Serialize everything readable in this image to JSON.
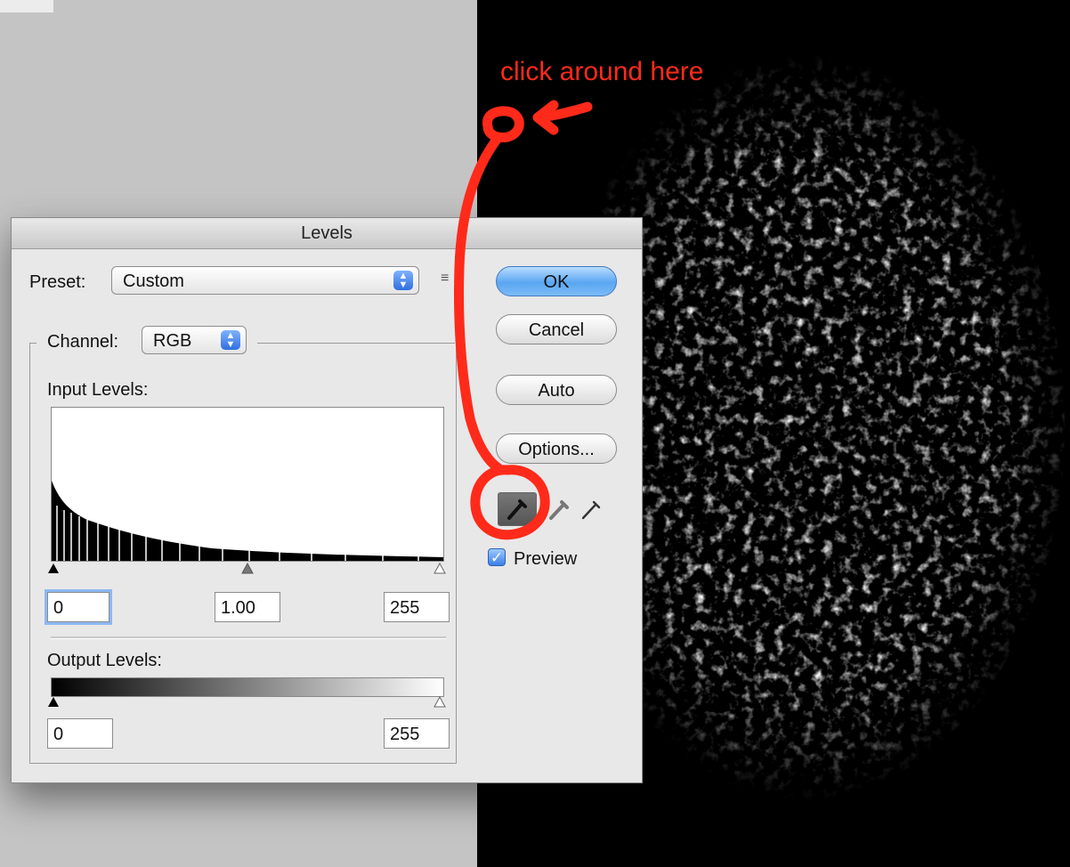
{
  "annotation": {
    "text": "click around here"
  },
  "dialog": {
    "title": "Levels",
    "preset_label": "Preset:",
    "preset_value": "Custom",
    "channel_label": "Channel:",
    "channel_value": "RGB",
    "input_levels_label": "Input Levels:",
    "input_black": "0",
    "input_gamma": "1.00",
    "input_white": "255",
    "output_levels_label": "Output Levels:",
    "output_black": "0",
    "output_white": "255",
    "buttons": {
      "ok": "OK",
      "cancel": "Cancel",
      "auto": "Auto",
      "options": "Options..."
    },
    "preview_label": "Preview",
    "preview_checked": true
  },
  "colors": {
    "annotation": "#ff2a1a",
    "accent": "#5aa6f2"
  }
}
